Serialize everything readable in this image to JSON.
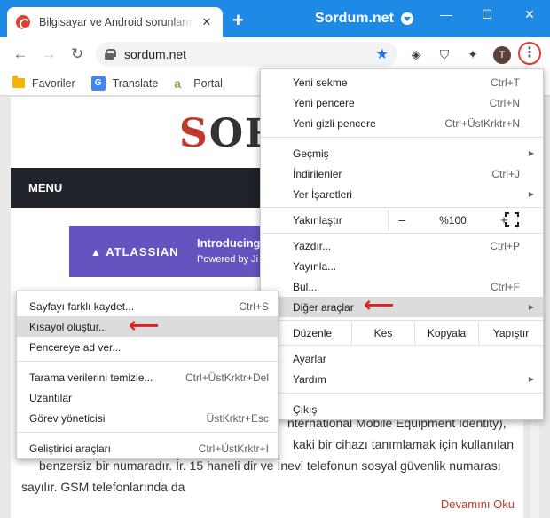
{
  "tab": {
    "title": "Bilgisayar ve Android sorunlarına çözüm",
    "close": "✕"
  },
  "titlebar": {
    "brand": "Sordum.net",
    "minimize": "—",
    "maximize": "☐",
    "close": "✕",
    "newtab": "+"
  },
  "toolbar": {
    "url": "sordum.net",
    "avatar": "T",
    "menu": "⋮",
    "back": "←",
    "forward": "→",
    "reload": "↻",
    "star": "★"
  },
  "bookmarks": [
    {
      "label": "Favoriler"
    },
    {
      "label": "Translate"
    },
    {
      "label": "Portal"
    }
  ],
  "page": {
    "logo_s": "S",
    "logo_rest": "OR",
    "menu_label": "MENU",
    "ad_brand": "ATLASSIAN",
    "ad_head": "Introducing",
    "ad_sub": "Powered by Ji",
    "article": [
      "nternational Mobile Equipment Identity),",
      "kaki bir cihazı tanımlamak için kullanılan",
      "benzersiz bir numaradır. İr. 15 haneli dir ve İnevi telefonun sosyal güvenlik numarası",
      "sayılır. GSM telefonlarında  da"
    ],
    "readmore": "Devamını Oku"
  },
  "menu": {
    "new_tab": {
      "label": "Yeni sekme",
      "shortcut": "Ctrl+T"
    },
    "new_window": {
      "label": "Yeni pencere",
      "shortcut": "Ctrl+N"
    },
    "incognito": {
      "label": "Yeni gizli pencere",
      "shortcut": "Ctrl+ÜstKrktr+N"
    },
    "history": {
      "label": "Geçmiş"
    },
    "downloads": {
      "label": "İndirilenler",
      "shortcut": "Ctrl+J"
    },
    "bookmarks": {
      "label": "Yer İşaretleri"
    },
    "zoom": {
      "label": "Yakınlaştır",
      "minus": "–",
      "value": "%100",
      "plus": "+"
    },
    "print": {
      "label": "Yazdır...",
      "shortcut": "Ctrl+P"
    },
    "cast": {
      "label": "Yayınla..."
    },
    "find": {
      "label": "Bul...",
      "shortcut": "Ctrl+F"
    },
    "more_tools": {
      "label": "Diğer araçlar"
    },
    "edit": {
      "label": "Düzenle",
      "cut": "Kes",
      "copy": "Kopyala",
      "paste": "Yapıştır"
    },
    "settings": {
      "label": "Ayarlar"
    },
    "help": {
      "label": "Yardım"
    },
    "exit": {
      "label": "Çıkış"
    }
  },
  "submenu": {
    "save_page": {
      "label": "Sayfayı farklı kaydet...",
      "shortcut": "Ctrl+S"
    },
    "create_shortcut": {
      "label": "Kısayol oluştur..."
    },
    "name_window": {
      "label": "Pencereye ad ver..."
    },
    "clear_data": {
      "label": "Tarama verilerini temizle...",
      "shortcut": "Ctrl+ÜstKrktr+Del"
    },
    "extensions": {
      "label": "Uzantılar"
    },
    "task_manager": {
      "label": "Görev yöneticisi",
      "shortcut": "ÜstKrktr+Esc"
    },
    "dev_tools": {
      "label": "Geliştirici araçları",
      "shortcut": "Ctrl+ÜstKrktr+I"
    }
  },
  "colors": {
    "accent": "#1f8ae6",
    "highlight_arrow": "#e02020"
  }
}
